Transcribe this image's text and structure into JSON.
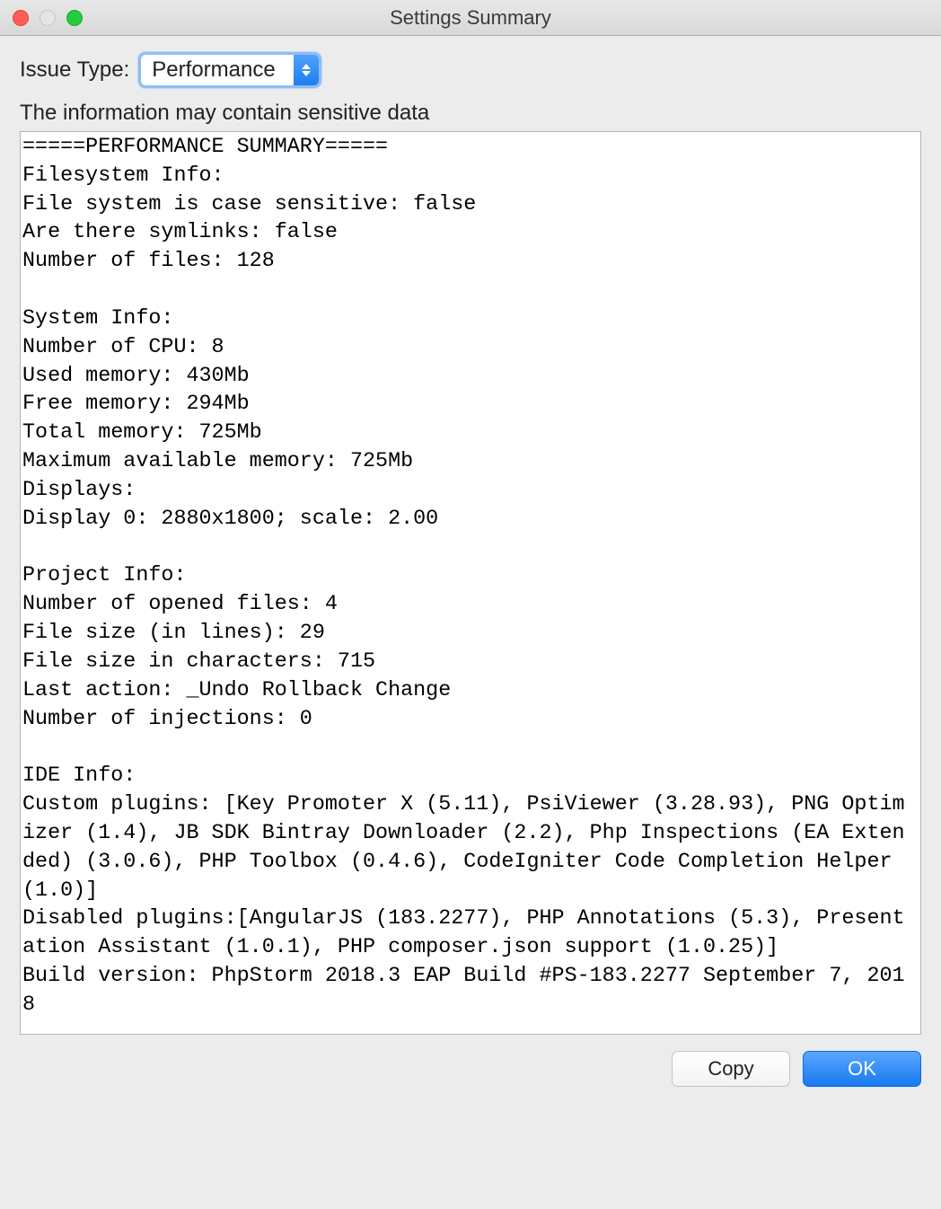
{
  "window": {
    "title": "Settings Summary"
  },
  "issue": {
    "label": "Issue Type:",
    "selected": "Performance"
  },
  "warning": "The information may contain sensitive data",
  "log": "=====PERFORMANCE SUMMARY=====\nFilesystem Info:\nFile system is case sensitive: false\nAre there symlinks: false\nNumber of files: 128\n\nSystem Info:\nNumber of CPU: 8\nUsed memory: 430Mb\nFree memory: 294Mb\nTotal memory: 725Mb\nMaximum available memory: 725Mb\nDisplays: \nDisplay 0: 2880x1800; scale: 2.00\n\nProject Info:\nNumber of opened files: 4\nFile size (in lines): 29\nFile size in characters: 715\nLast action: _Undo Rollback Change\nNumber of injections: 0\n\nIDE Info:\nCustom plugins: [Key Promoter X (5.11), PsiViewer (3.28.93), PNG Optimizer (1.4), JB SDK Bintray Downloader (2.2), Php Inspections (EA Extended) (3.0.6), PHP Toolbox (0.4.6), CodeIgniter Code Completion Helper (1.0)]\nDisabled plugins:[AngularJS (183.2277), PHP Annotations (5.3), Presentation Assistant (1.0.1), PHP composer.json support (1.0.25)]\nBuild version: PhpStorm 2018.3 EAP Build #PS-183.2277 September 7, 2018",
  "buttons": {
    "copy": "Copy",
    "ok": "OK"
  }
}
